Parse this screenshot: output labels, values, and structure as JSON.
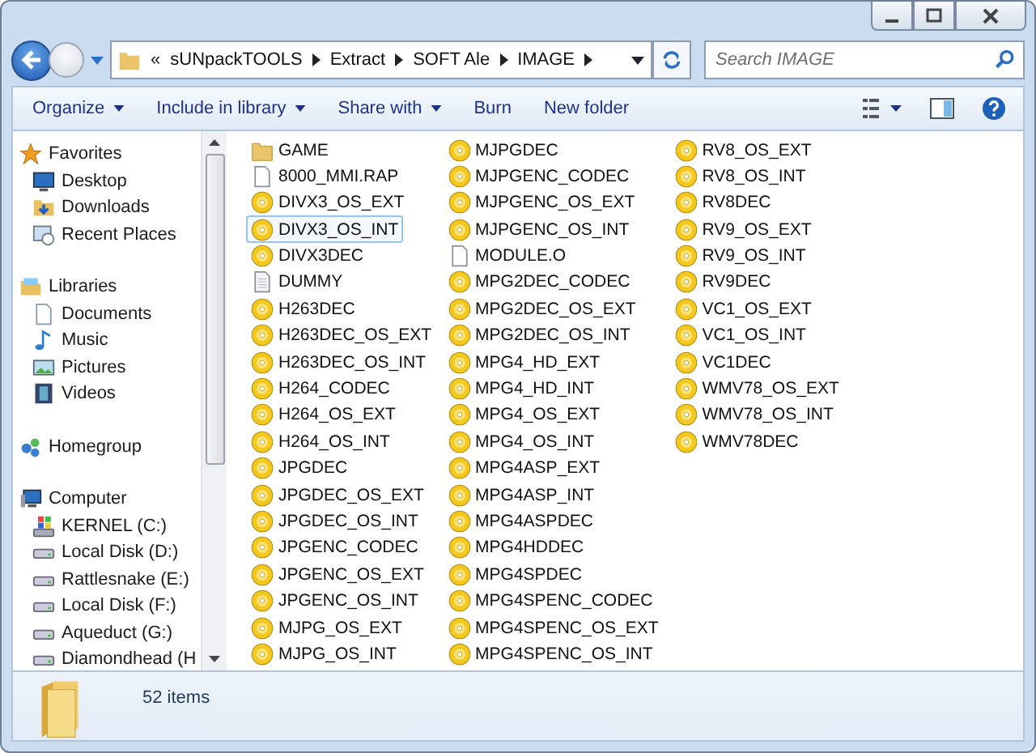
{
  "address": {
    "overflow": "«",
    "crumbs": [
      "sUNpackTOOLS",
      "Extract",
      "SOFT Ale",
      "IMAGE"
    ]
  },
  "search": {
    "placeholder": "Search IMAGE"
  },
  "toolbar": {
    "buttons": [
      {
        "label": "Organize",
        "dropdown": true
      },
      {
        "label": "Include in library",
        "dropdown": true
      },
      {
        "label": "Share with",
        "dropdown": true
      },
      {
        "label": "Burn",
        "dropdown": false
      },
      {
        "label": "New folder",
        "dropdown": false
      }
    ]
  },
  "sidebar": {
    "groups": [
      {
        "label": "Favorites",
        "kind": "star",
        "children": [
          {
            "label": "Desktop",
            "kind": "desktop"
          },
          {
            "label": "Downloads",
            "kind": "downloads"
          },
          {
            "label": "Recent Places",
            "kind": "recent"
          }
        ]
      },
      {
        "label": "Libraries",
        "kind": "library",
        "children": [
          {
            "label": "Documents",
            "kind": "document"
          },
          {
            "label": "Music",
            "kind": "music"
          },
          {
            "label": "Pictures",
            "kind": "picture"
          },
          {
            "label": "Videos",
            "kind": "video"
          }
        ]
      },
      {
        "label": "Homegroup",
        "kind": "homegroup"
      },
      {
        "label": "Computer",
        "kind": "computer",
        "children": [
          {
            "label": "KERNEL (C:)",
            "kind": "system-drive"
          },
          {
            "label": "Local Disk (D:)",
            "kind": "drive"
          },
          {
            "label": "Rattlesnake (E:)",
            "kind": "drive"
          },
          {
            "label": "Local Disk (F:)",
            "kind": "drive"
          },
          {
            "label": "Aqueduct (G:)",
            "kind": "drive"
          },
          {
            "label": "Diamondhead (H",
            "kind": "drive"
          }
        ]
      }
    ]
  },
  "files": [
    {
      "name": "GAME",
      "kind": "folder",
      "selected": false
    },
    {
      "name": "8000_MMI.RAP",
      "kind": "file",
      "selected": false
    },
    {
      "name": "DIVX3_OS_EXT",
      "kind": "disc",
      "selected": false
    },
    {
      "name": "DIVX3_OS_INT",
      "kind": "disc",
      "selected": true
    },
    {
      "name": "DIVX3DEC",
      "kind": "disc",
      "selected": false
    },
    {
      "name": "DUMMY",
      "kind": "text",
      "selected": false
    },
    {
      "name": "H263DEC",
      "kind": "disc",
      "selected": false
    },
    {
      "name": "H263DEC_OS_EXT",
      "kind": "disc",
      "selected": false
    },
    {
      "name": "H263DEC_OS_INT",
      "kind": "disc",
      "selected": false
    },
    {
      "name": "H264_CODEC",
      "kind": "disc",
      "selected": false
    },
    {
      "name": "H264_OS_EXT",
      "kind": "disc",
      "selected": false
    },
    {
      "name": "H264_OS_INT",
      "kind": "disc",
      "selected": false
    },
    {
      "name": "JPGDEC",
      "kind": "disc",
      "selected": false
    },
    {
      "name": "JPGDEC_OS_EXT",
      "kind": "disc",
      "selected": false
    },
    {
      "name": "JPGDEC_OS_INT",
      "kind": "disc",
      "selected": false
    },
    {
      "name": "JPGENC_CODEC",
      "kind": "disc",
      "selected": false
    },
    {
      "name": "JPGENC_OS_EXT",
      "kind": "disc",
      "selected": false
    },
    {
      "name": "JPGENC_OS_INT",
      "kind": "disc",
      "selected": false
    },
    {
      "name": "MJPG_OS_EXT",
      "kind": "disc",
      "selected": false
    },
    {
      "name": "MJPG_OS_INT",
      "kind": "disc",
      "selected": false
    },
    {
      "name": "MJPGDEC",
      "kind": "disc",
      "selected": false
    },
    {
      "name": "MJPGENC_CODEC",
      "kind": "disc",
      "selected": false
    },
    {
      "name": "MJPGENC_OS_EXT",
      "kind": "disc",
      "selected": false
    },
    {
      "name": "MJPGENC_OS_INT",
      "kind": "disc",
      "selected": false
    },
    {
      "name": "MODULE.O",
      "kind": "file",
      "selected": false
    },
    {
      "name": "MPG2DEC_CODEC",
      "kind": "disc",
      "selected": false
    },
    {
      "name": "MPG2DEC_OS_EXT",
      "kind": "disc",
      "selected": false
    },
    {
      "name": "MPG2DEC_OS_INT",
      "kind": "disc",
      "selected": false
    },
    {
      "name": "MPG4_HD_EXT",
      "kind": "disc",
      "selected": false
    },
    {
      "name": "MPG4_HD_INT",
      "kind": "disc",
      "selected": false
    },
    {
      "name": "MPG4_OS_EXT",
      "kind": "disc",
      "selected": false
    },
    {
      "name": "MPG4_OS_INT",
      "kind": "disc",
      "selected": false
    },
    {
      "name": "MPG4ASP_EXT",
      "kind": "disc",
      "selected": false
    },
    {
      "name": "MPG4ASP_INT",
      "kind": "disc",
      "selected": false
    },
    {
      "name": "MPG4ASPDEC",
      "kind": "disc",
      "selected": false
    },
    {
      "name": "MPG4HDDEC",
      "kind": "disc",
      "selected": false
    },
    {
      "name": "MPG4SPDEC",
      "kind": "disc",
      "selected": false
    },
    {
      "name": "MPG4SPENC_CODEC",
      "kind": "disc",
      "selected": false
    },
    {
      "name": "MPG4SPENC_OS_EXT",
      "kind": "disc",
      "selected": false
    },
    {
      "name": "MPG4SPENC_OS_INT",
      "kind": "disc",
      "selected": false
    },
    {
      "name": "RV8_OS_EXT",
      "kind": "disc",
      "selected": false
    },
    {
      "name": "RV8_OS_INT",
      "kind": "disc",
      "selected": false
    },
    {
      "name": "RV8DEC",
      "kind": "disc",
      "selected": false
    },
    {
      "name": "RV9_OS_EXT",
      "kind": "disc",
      "selected": false
    },
    {
      "name": "RV9_OS_INT",
      "kind": "disc",
      "selected": false
    },
    {
      "name": "RV9DEC",
      "kind": "disc",
      "selected": false
    },
    {
      "name": "VC1_OS_EXT",
      "kind": "disc",
      "selected": false
    },
    {
      "name": "VC1_OS_INT",
      "kind": "disc",
      "selected": false
    },
    {
      "name": "VC1DEC",
      "kind": "disc",
      "selected": false
    },
    {
      "name": "WMV78_OS_EXT",
      "kind": "disc",
      "selected": false
    },
    {
      "name": "WMV78_OS_INT",
      "kind": "disc",
      "selected": false
    },
    {
      "name": "WMV78DEC",
      "kind": "disc",
      "selected": false
    }
  ],
  "details": {
    "count": "52 items"
  }
}
